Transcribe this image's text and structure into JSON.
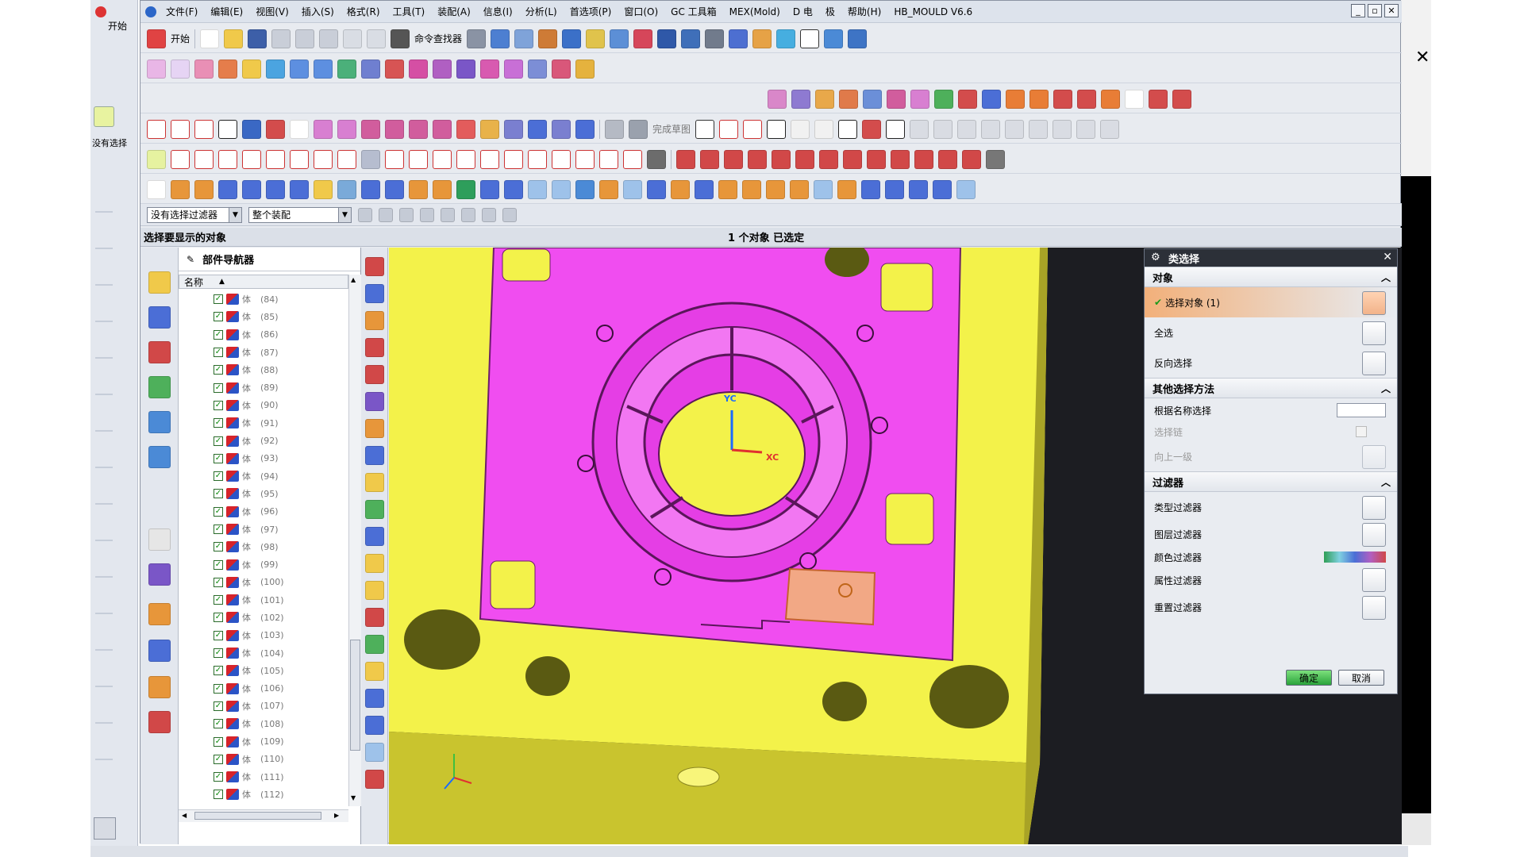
{
  "menu": [
    "文件(F)",
    "编辑(E)",
    "视图(V)",
    "插入(S)",
    "格式(R)",
    "工具(T)",
    "装配(A)",
    "信息(I)",
    "分析(L)",
    "首选项(P)",
    "窗口(O)",
    "GC 工具箱",
    "MEX(Mold)",
    "D 电",
    "极",
    "帮助(H)",
    "HB_MOULD V6.6"
  ],
  "window_controls": [
    "_",
    "▫",
    "✕"
  ],
  "toolbar": {
    "start": "开始",
    "command_finder": "命令查找器",
    "sketch_done": "完成草图"
  },
  "filter": {
    "type_filter": "没有选择过滤器",
    "scope": "整个装配"
  },
  "status": {
    "prompt": "选择要显示的对象",
    "selected": "1 个对象 已选定"
  },
  "navigator": {
    "title": "部件导航器",
    "column": "名称",
    "rows": [
      {
        "name": "体",
        "id": "(84)"
      },
      {
        "name": "体",
        "id": "(85)"
      },
      {
        "name": "体",
        "id": "(86)"
      },
      {
        "name": "体",
        "id": "(87)"
      },
      {
        "name": "体",
        "id": "(88)"
      },
      {
        "name": "体",
        "id": "(89)"
      },
      {
        "name": "体",
        "id": "(90)"
      },
      {
        "name": "体",
        "id": "(91)"
      },
      {
        "name": "体",
        "id": "(92)"
      },
      {
        "name": "体",
        "id": "(93)"
      },
      {
        "name": "体",
        "id": "(94)"
      },
      {
        "name": "体",
        "id": "(95)"
      },
      {
        "name": "体",
        "id": "(96)"
      },
      {
        "name": "体",
        "id": "(97)"
      },
      {
        "name": "体",
        "id": "(98)"
      },
      {
        "name": "体",
        "id": "(99)"
      },
      {
        "name": "体",
        "id": "(100)"
      },
      {
        "name": "体",
        "id": "(101)"
      },
      {
        "name": "体",
        "id": "(102)"
      },
      {
        "name": "体",
        "id": "(103)"
      },
      {
        "name": "体",
        "id": "(104)"
      },
      {
        "name": "体",
        "id": "(105)"
      },
      {
        "name": "体",
        "id": "(106)"
      },
      {
        "name": "体",
        "id": "(107)"
      },
      {
        "name": "体",
        "id": "(108)"
      },
      {
        "name": "体",
        "id": "(109)"
      },
      {
        "name": "体",
        "id": "(110)"
      },
      {
        "name": "体",
        "id": "(111)"
      },
      {
        "name": "体",
        "id": "(112)"
      }
    ]
  },
  "viewport": {
    "axis_y": "YC",
    "axis_x": "XC"
  },
  "dialog": {
    "title": "类选择",
    "sections": {
      "object": "对象",
      "other": "其他选择方法",
      "filters": "过滤器"
    },
    "object_items": {
      "select": "选择对象 (1)",
      "all": "全选",
      "invert": "反向选择"
    },
    "other_items": {
      "by_name": "根据名称选择",
      "chain": "选择链",
      "up_level": "向上一级"
    },
    "filter_items": {
      "type": "类型过滤器",
      "layer": "图层过滤器",
      "color": "颜色过滤器",
      "attribute": "属性过滤器",
      "reset": "重置过滤器"
    },
    "ok": "确定",
    "cancel": "取消"
  },
  "left_strip": {
    "start": "开始",
    "no_filter": "没有选择"
  },
  "colors": {
    "magenta": "#f04df0",
    "yellow": "#f3f24a",
    "highlight": "#f3b27a"
  }
}
